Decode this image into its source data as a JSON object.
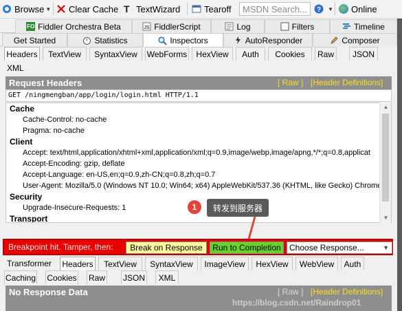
{
  "toolbar": {
    "browse": "Browse",
    "clear_cache": "Clear Cache",
    "textwizard": "TextWizard",
    "tearoff": "Tearoff",
    "search_placeholder": "MSDN Search...",
    "online": "Online"
  },
  "main_tabs_row1": [
    "Fiddler Orchestra Beta",
    "FiddlerScript",
    "Log",
    "Filters",
    "Timeline"
  ],
  "main_tabs_row2": [
    "Get Started",
    "Statistics",
    "Inspectors",
    "AutoResponder",
    "Composer"
  ],
  "request_tabs": [
    "Headers",
    "TextView",
    "SyntaxView",
    "WebForms",
    "HexView",
    "Auth",
    "Cookies",
    "Raw",
    "JSON",
    "XML"
  ],
  "request_headers": {
    "title": "Request Headers",
    "raw_link": "[ Raw ]",
    "defs_link": "[Header Definitions]",
    "request_line": "GET /ningmengban/app/login/login.html HTTP/1.1",
    "groups": [
      {
        "name": "Cache",
        "items": [
          "Cache-Control: no-cache",
          "Pragma: no-cache"
        ]
      },
      {
        "name": "Client",
        "items": [
          "Accept: text/html,application/xhtml+xml,application/xml;q=0.9,image/webp,image/apng,*/*;q=0.8,applicat",
          "Accept-Encoding: gzip, deflate",
          "Accept-Language: en-US,en;q=0.9,zh-CN;q=0.8,zh;q=0.7",
          "User-Agent: Mozilla/5.0 (Windows NT 10.0; Win64; x64) AppleWebKit/537.36 (KHTML, like Gecko) Chrome/8"
        ]
      },
      {
        "name": "Security",
        "items": [
          "Upgrade-Insecure-Requests: 1"
        ]
      },
      {
        "name": "Transport",
        "items": []
      }
    ]
  },
  "callout": {
    "number": "1",
    "text": "转发到服务器"
  },
  "breakpoint": {
    "message": "Breakpoint hit. Tamper, then:",
    "break_on_response": "Break on Response",
    "run_to_completion": "Run to Completion",
    "choose_response": "Choose Response..."
  },
  "response_tabs_row1": [
    "Transformer",
    "Headers",
    "TextView",
    "SyntaxView",
    "ImageView",
    "HexView",
    "WebView",
    "Auth"
  ],
  "response_tabs_row2": [
    "Caching",
    "Cookies",
    "Raw",
    "JSON",
    "XML"
  ],
  "response": {
    "title": "No Response Data",
    "raw_link": "[ Raw ]",
    "defs_link": "[Header Definitions]",
    "watermark": "https://blog.csdn.net/Raindrop01"
  },
  "colors": {
    "breakpoint_bar": "#e60000",
    "break_button": "#fdfba0",
    "run_button": "#69d12b",
    "header_link": "#ffde1f",
    "callout_badge": "#e5433a"
  }
}
